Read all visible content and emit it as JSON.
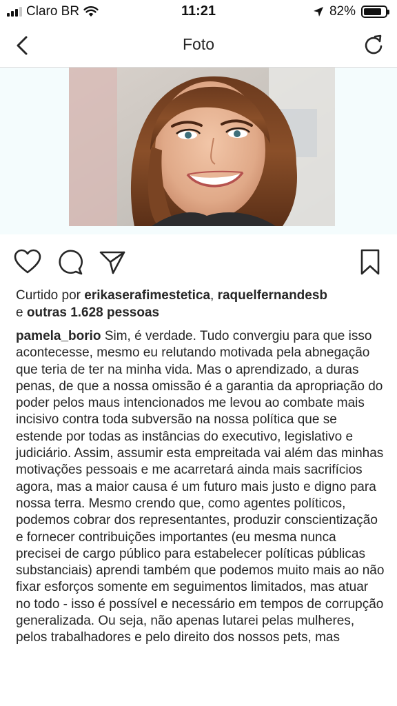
{
  "status_bar": {
    "carrier": "Claro BR",
    "time": "11:21",
    "battery": "82%",
    "battery_level": 0.82
  },
  "nav": {
    "title": "Foto",
    "back_icon": "chevron-left-icon",
    "refresh_icon": "refresh-icon"
  },
  "post": {
    "likes_prefix": "Curtido por ",
    "liker_1": "erikaserafimestetica",
    "likes_sep": ", ",
    "liker_2": "raquelfernandesb",
    "likes_and": "e ",
    "likes_others": "outras 1.628 pessoas",
    "username": "pamela_borio",
    "caption": " Sim, é verdade. Tudo convergiu para que isso acontecesse, mesmo eu relutando motivada pela abnegação que teria de ter na minha vida. Mas o aprendizado, a duras penas, de que a nossa omissão é a garantia da apropriação do poder pelos maus intencionados me levou ao combate mais incisivo contra toda subversão na nossa política que se estende por todas as instâncias do executivo, legislativo e judiciário. Assim, assumir esta empreitada vai além das minhas motivações pessoais e me acarretará ainda mais sacrifícios agora, mas a maior causa é um futuro mais justo e digno para nossa terra. Mesmo crendo que, como agentes políticos, podemos cobrar dos representantes, produzir conscientização e fornecer contribuições importantes (eu mesma nunca precisei de cargo público para estabelecer políticas públicas substanciais) aprendi também que podemos muito mais ao não fixar esforços somente em seguimentos limitados, mas atuar no todo - isso é possível e necessário em tempos de corrupção generalizada. Ou seja, não apenas lutarei pelas mulheres, pelos trabalhadores e pelo direito dos nossos pets, mas"
  },
  "icons": {
    "like": "heart-icon",
    "comment": "comment-icon",
    "share": "send-icon",
    "save": "bookmark-icon"
  }
}
